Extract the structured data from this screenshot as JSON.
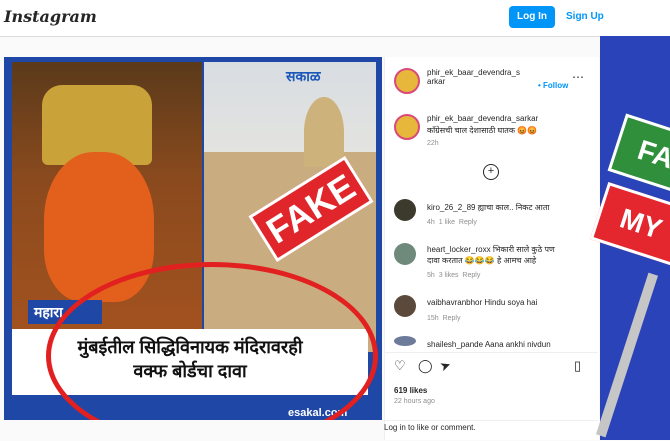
{
  "app": {
    "logo": "Instagram"
  },
  "header": {
    "login_label": "Log In",
    "signup_label": "Sign Up"
  },
  "post": {
    "image": {
      "brand_watermark": "सकाळ",
      "stamp": "FAKE",
      "category_strip": "महारा",
      "headline_line1": "मुंबईतील सिद्धिविनायक मंदिरावरही",
      "headline_line2": "वक्फ बोर्डचा दावा",
      "site": "esakal.com"
    },
    "author": {
      "username_line1": "phir_ek_baar_devendra_s",
      "username_line2": "arkar",
      "follow_label": "• Follow"
    },
    "caption": {
      "username": "phir_ek_baar_devendra_sarkar",
      "text": "काँग्रेसची चाल देशासाठी घातक 😡😡",
      "time": "22h"
    },
    "comments": [
      {
        "username": "kiro_26_2_89",
        "text": "ह्याचा काल.. निकट आता",
        "time": "4h",
        "likes": "1 like",
        "reply": "Reply"
      },
      {
        "username": "heart_locker_roxx",
        "text": "भिकारी साले कुठे पण",
        "text2": "दावा करतात 😂😂😂 हे आमच आहे",
        "time": "5h",
        "likes": "3 likes",
        "reply": "Reply"
      },
      {
        "username": "vaibhavranbhor",
        "text": "Hindu soya hai",
        "time": "15h",
        "reply": "Reply"
      },
      {
        "username": "shailesh_pande",
        "text": "Aana ankhi nivdun",
        "time": "",
        "reply": ""
      }
    ],
    "likes": "619 likes",
    "posted": "22 hours ago",
    "login_prompt": "Log in to like or comment."
  },
  "background_sign": {
    "line1": "FA",
    "line2": "MY"
  },
  "colors": {
    "accent": "#0095f6",
    "stamp": "#e0262b",
    "post_frame": "#1f47a6"
  }
}
